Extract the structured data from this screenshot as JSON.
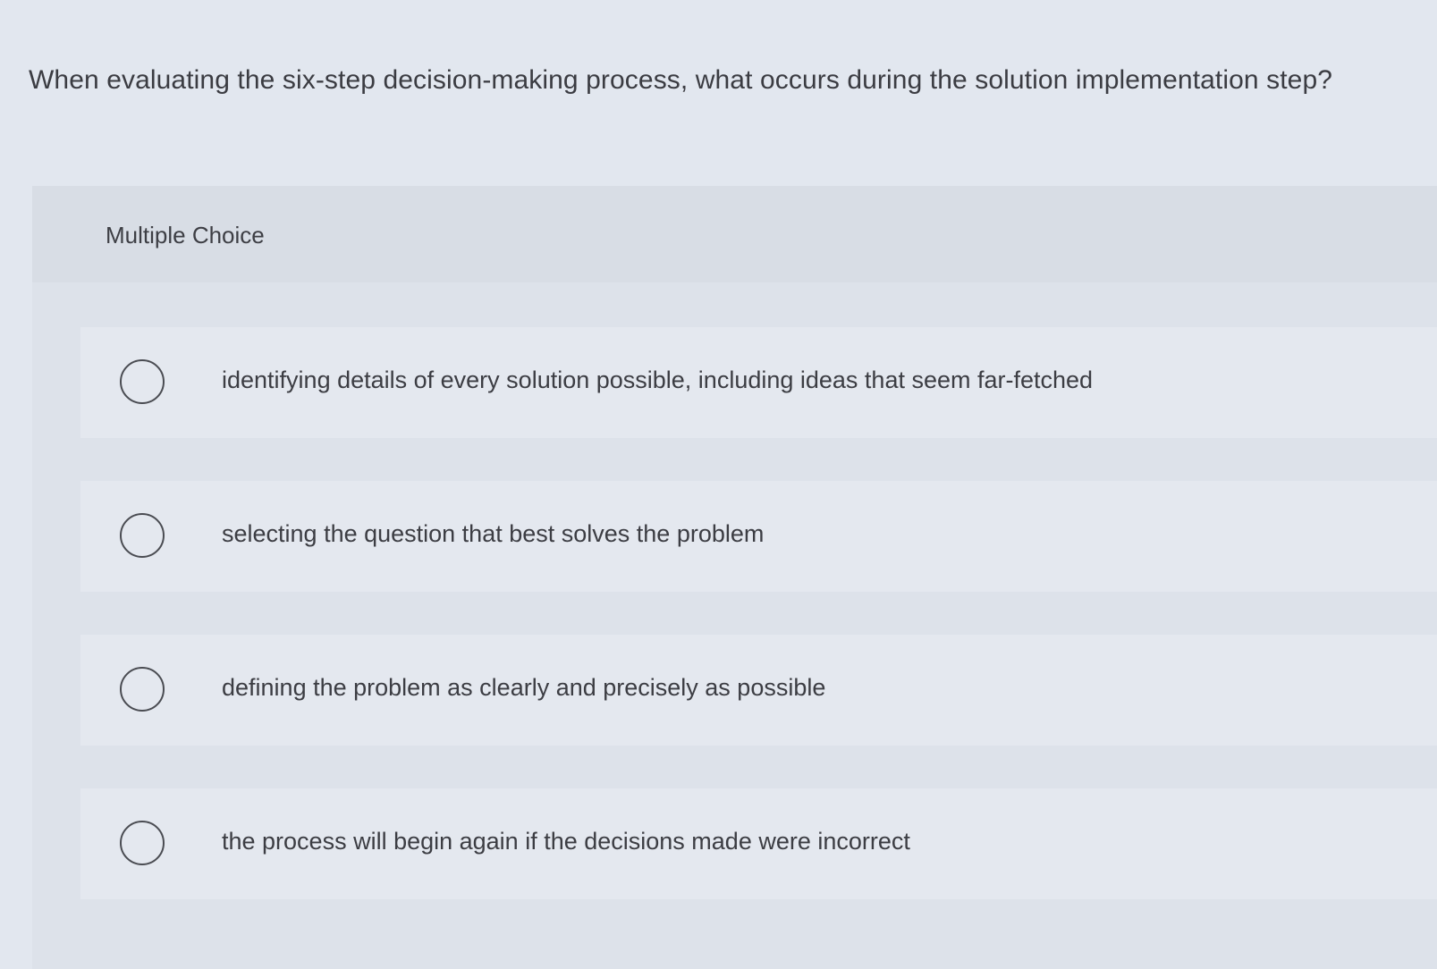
{
  "question": {
    "text": "When evaluating the six-step decision-making process, what occurs during the solution implementation step?"
  },
  "multiple_choice": {
    "label": "Multiple Choice",
    "options": [
      {
        "text": "identifying details of every solution possible, including ideas that seem far-fetched"
      },
      {
        "text": "selecting the question that best solves the problem"
      },
      {
        "text": "defining the problem as clearly and precisely as possible"
      },
      {
        "text": "the process will begin again if the decisions made were incorrect"
      }
    ]
  },
  "colors": {
    "page_background": "#e2e7ef",
    "panel_background": "#dde2ea",
    "option_background": "#e4e8ef",
    "text": "#3b3c42",
    "radio_border": "#4a4c52"
  }
}
